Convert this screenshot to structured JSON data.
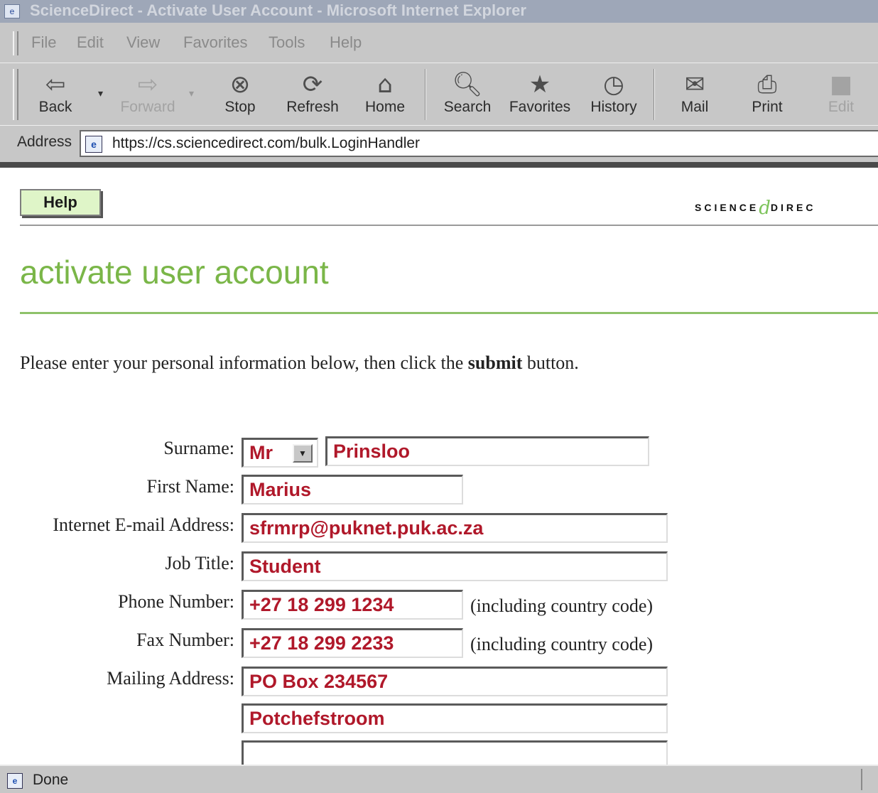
{
  "window": {
    "title": "ScienceDirect - Activate User Account - Microsoft Internet Explorer"
  },
  "menu": [
    "File",
    "Edit",
    "View",
    "Favorites",
    "Tools",
    "Help"
  ],
  "toolbar": {
    "back": "Back",
    "forward": "Forward",
    "stop": "Stop",
    "refresh": "Refresh",
    "home": "Home",
    "search": "Search",
    "favorites": "Favorites",
    "history": "History",
    "mail": "Mail",
    "print": "Print",
    "edit": "Edit"
  },
  "address": {
    "label": "Address",
    "url": "https://cs.sciencedirect.com/bulk.LoginHandler"
  },
  "page": {
    "help_button": "Help",
    "logo_left": "SCIENCE",
    "logo_right": "DIREC",
    "title": "activate user account",
    "intro_before": "Please enter your personal information below, then click the ",
    "intro_bold": "submit",
    "intro_after": " button."
  },
  "form": {
    "surname_label": "Surname:",
    "salutation": "Mr",
    "surname": "Prinsloo",
    "first_name_label": "First Name:",
    "first_name": "Marius",
    "email_label": "Internet E-mail Address:",
    "email": "sfrmrp@puknet.puk.ac.za",
    "job_title_label": "Job Title:",
    "job_title": "Student",
    "phone_label": "Phone Number:",
    "phone": "+27 18 299 1234",
    "phone_hint": "(including country code)",
    "fax_label": "Fax Number:",
    "fax": "+27 18 299 2233",
    "fax_hint": "(including country code)",
    "mailing_label": "Mailing Address:",
    "address_line1": "PO Box 234567",
    "address_line2": "Potchefstroom",
    "address_line3": ""
  },
  "status": {
    "text": "Done"
  }
}
